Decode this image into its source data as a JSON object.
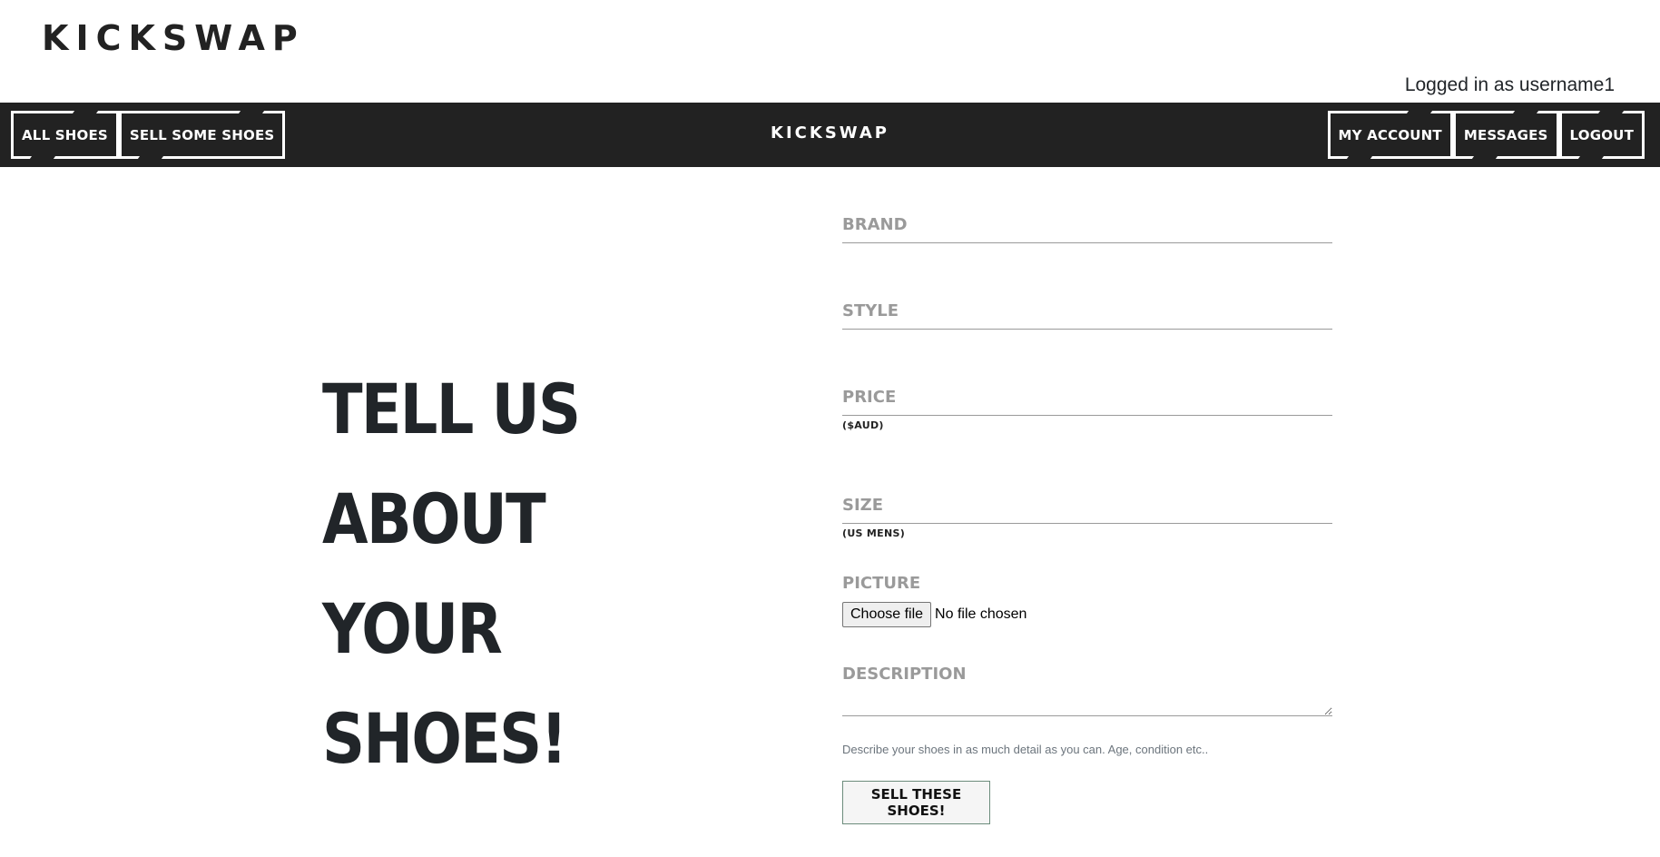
{
  "header": {
    "logo": "KICKSWAP",
    "login_status": "Logged in as username1"
  },
  "nav": {
    "left_items": [
      {
        "label": "ALL SHOES"
      },
      {
        "label": "SELL SOME SHOES"
      }
    ],
    "center_title": "KICKSWAP",
    "right_items": [
      {
        "label": "MY ACCOUNT"
      },
      {
        "label": "MESSAGES"
      },
      {
        "label": "LOGOUT"
      }
    ]
  },
  "hero": {
    "line1": "TELL US",
    "line2": "ABOUT YOUR",
    "line3": "SHOES!"
  },
  "form": {
    "brand": {
      "placeholder": "Brand",
      "value": ""
    },
    "style": {
      "placeholder": "Style",
      "value": ""
    },
    "price": {
      "placeholder": "Price",
      "value": "",
      "hint": "($AUD)"
    },
    "size": {
      "placeholder": "Size",
      "value": "",
      "hint": "(US MENS)"
    },
    "picture": {
      "label": "Picture",
      "button": "Choose file",
      "status": "No file chosen"
    },
    "description": {
      "label": "Description",
      "value": "",
      "help": "Describe your shoes in as much detail as you can. Age, condition etc.."
    },
    "submit_label": "SELL THESE SHOES!"
  }
}
